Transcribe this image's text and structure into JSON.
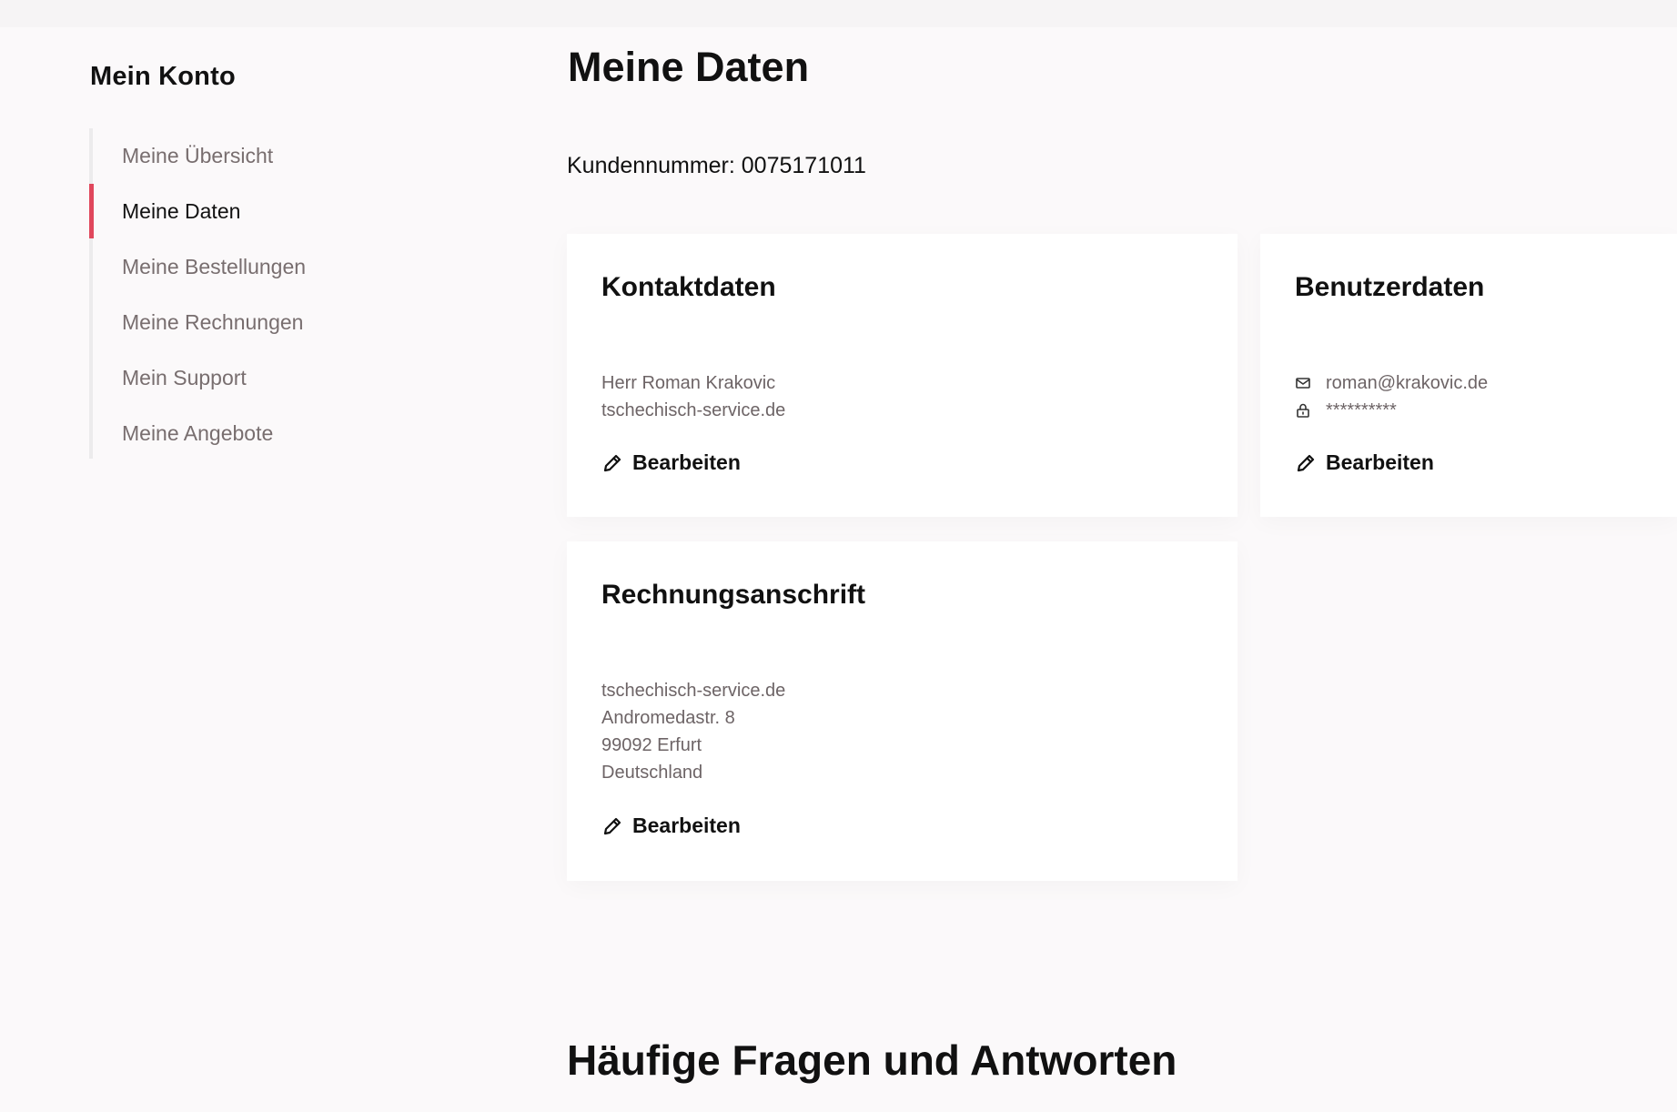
{
  "sidebar": {
    "title": "Mein Konto",
    "items": [
      {
        "label": "Meine Übersicht",
        "active": false
      },
      {
        "label": "Meine Daten",
        "active": true
      },
      {
        "label": "Meine Bestellungen",
        "active": false
      },
      {
        "label": "Meine Rechnungen",
        "active": false
      },
      {
        "label": "Mein Support",
        "active": false
      },
      {
        "label": "Meine Angebote",
        "active": false
      }
    ]
  },
  "main": {
    "title": "Meine Daten",
    "customer_number": "Kundennummer: 0075171011",
    "contact": {
      "title": "Kontaktdaten",
      "lines": [
        "Herr Roman Krakovic",
        "tschechisch-service.de"
      ],
      "edit_label": "Bearbeiten"
    },
    "user": {
      "title": "Benutzerdaten",
      "email": "roman@krakovic.de",
      "password": "**********",
      "edit_label": "Bearbeiten"
    },
    "billing": {
      "title": "Rechnungsanschrift",
      "lines": [
        "tschechisch-service.de",
        "Andromedastr. 8",
        "99092 Erfurt",
        "Deutschland"
      ],
      "edit_label": "Bearbeiten"
    },
    "faq_title": "Häufige Fragen und Antworten"
  },
  "colors": {
    "accent": "#e0475c",
    "background": "#fbf9fa",
    "muted_text": "#786e6f"
  },
  "icons": {
    "edit": "pencil-icon",
    "email": "mail-icon",
    "password": "lock-icon"
  }
}
